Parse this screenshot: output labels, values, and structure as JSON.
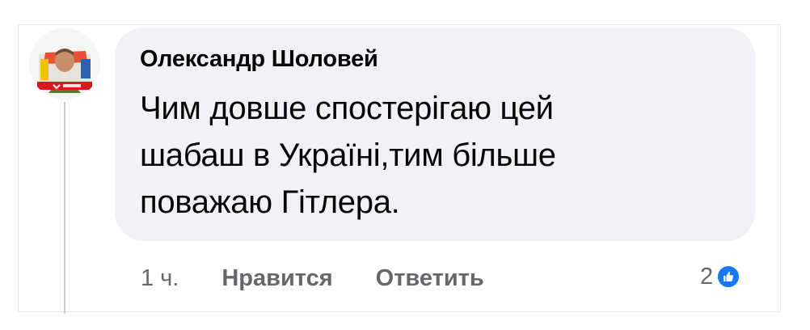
{
  "comment": {
    "author": "Олександр Шоловей",
    "text": "Чим довше спостерігаю цей\nшабаш в Україні,тим більше\nповажаю Гітлера.",
    "time": "1 ч.",
    "like_label": "Нравится",
    "reply_label": "Ответить",
    "reaction_count": "2",
    "reaction_icon": "like-icon"
  },
  "colors": {
    "bubble_bg": "#f0f2f5",
    "text": "#050505",
    "secondary_text": "#65676b",
    "like_blue": "#1877f2"
  }
}
